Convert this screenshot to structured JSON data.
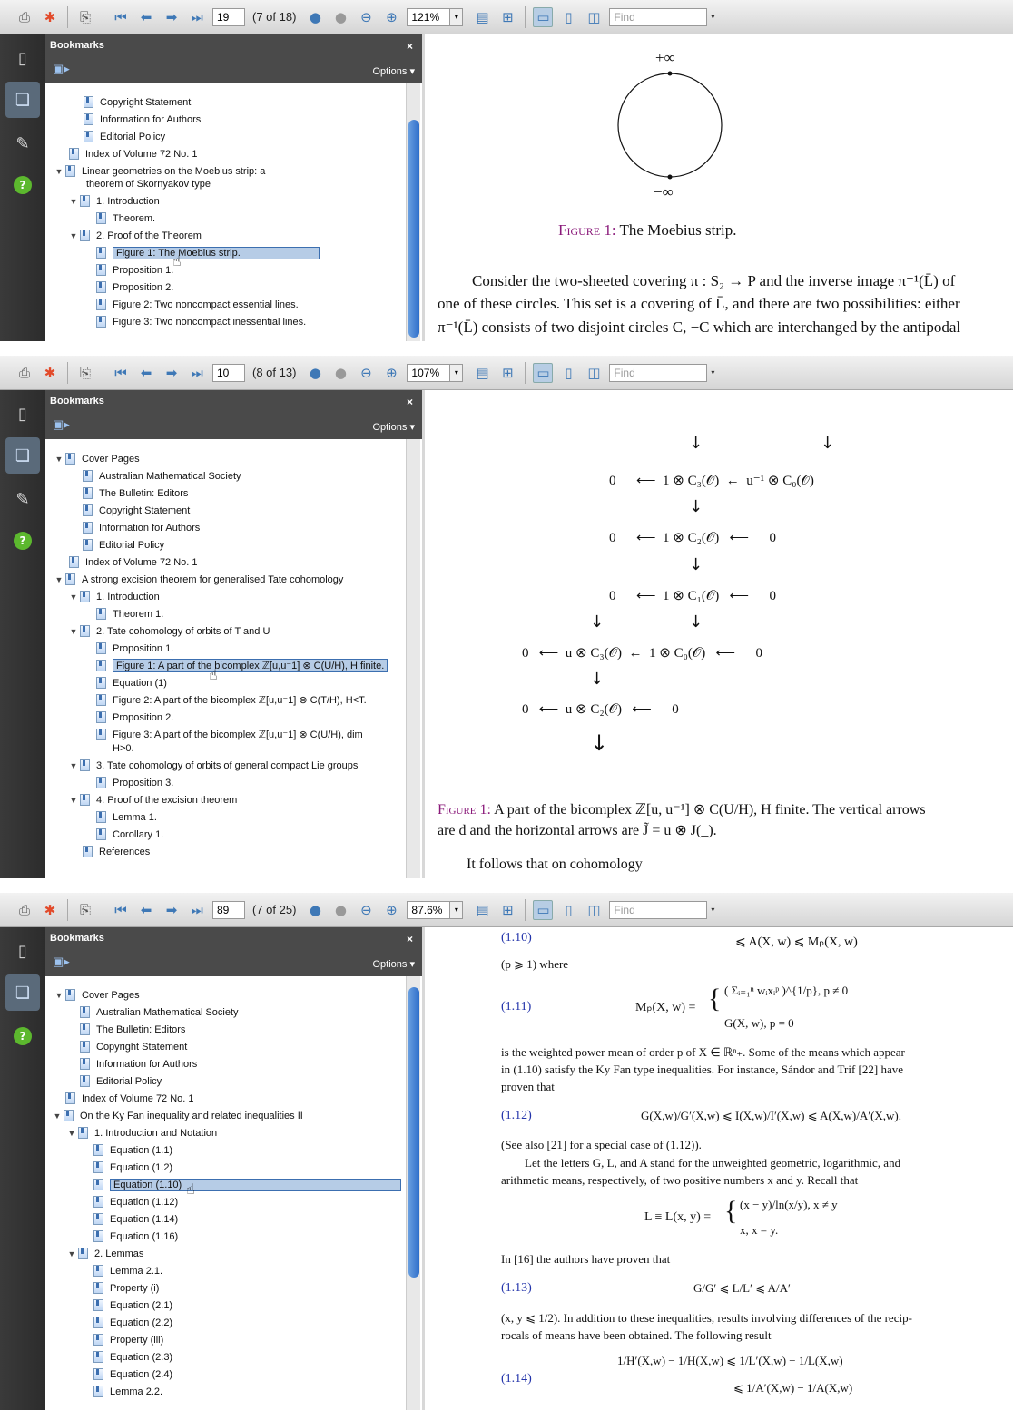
{
  "app": {
    "find_placeholder": "Find",
    "sidebar_title": "Bookmarks",
    "options_label": "Options",
    "close_glyph": "×",
    "help_glyph": "?"
  },
  "windows": [
    {
      "page": "19",
      "page_of": "(7 of 18)",
      "zoom": "121%",
      "tree": [
        "Copyright Statement",
        "Information for Authors",
        "Editorial Policy",
        "Index of Volume 72 No. 1",
        "Linear geometries on the Moebius strip: a",
        "theorem of Skornyakov type",
        "1. Introduction",
        "Theorem.",
        "2. Proof of the Theorem",
        "Figure 1: The Moebius strip.",
        "Proposition 1.",
        "Proposition 2.",
        "Figure 2: Two noncompact essential lines.",
        "Figure 3: Two noncompact inessential lines."
      ],
      "content": {
        "plus_inf": "+∞",
        "minus_inf": "−∞",
        "fig_label": "Figure 1:",
        "fig_caption": "The Moebius strip.",
        "line1": "Consider the two-sheeted covering π : S₂ → P and the inverse image π⁻¹(L̄) of",
        "line2": "one of these circles. This set is a covering of L̄, and there are two possibilities: either",
        "line3": "π⁻¹(L̄) consists of two disjoint circles C, −C which are interchanged by the antipodal"
      }
    },
    {
      "page": "10",
      "page_of": "(8 of 13)",
      "zoom": "107%",
      "tree": [
        "Cover Pages",
        "Australian Mathematical Society",
        "The Bulletin: Editors",
        "Copyright Statement",
        "Information for Authors",
        "Editorial Policy",
        "Index of Volume 72 No. 1",
        "A strong excision theorem for generalised Tate cohomology",
        "1. Introduction",
        "Theorem 1.",
        "2. Tate cohomology of orbits of T and U",
        "Proposition 1.",
        "Figure 1: A part of the bicomplex ℤ[u,u⁻1] ⊗ C(U/H), H finite.",
        "Equation (1)",
        "Figure 2: A part of the bicomplex ℤ[u,u⁻1] ⊗ C(T/H), H<T.",
        "Proposition 2.",
        "Figure 3: A part of the bicomplex ℤ[u,u⁻1] ⊗ C(U/H),  dim",
        "H>0.",
        "3. Tate cohomology of orbits of general compact Lie groups",
        "Proposition 3.",
        "4. Proof of the excision theorem",
        "Lemma 1.",
        "Corollary 1.",
        "References"
      ],
      "content": {
        "r1": [
          "0",
          "⟵",
          "1 ⊗ C₃(𝒪)",
          "←",
          "u⁻¹ ⊗ C₀(𝒪)"
        ],
        "r2": [
          "0",
          "⟵",
          "1 ⊗ C₂(𝒪)",
          "⟵",
          "0"
        ],
        "r3": [
          "0",
          "⟵",
          "1 ⊗ C₁(𝒪)",
          "⟵",
          "0"
        ],
        "r4": [
          "0",
          "⟵",
          "u ⊗ C₃(𝒪)",
          "←",
          "1 ⊗ C₀(𝒪)",
          "⟵",
          "0"
        ],
        "r5": [
          "0",
          "⟵",
          "u ⊗ C₂(𝒪)",
          "⟵",
          "0"
        ],
        "cap_label": "Figure 1:",
        "cap1": "A part of the bicomplex ℤ[u, u⁻¹] ⊗ C(U/H), H finite. The vertical arrows",
        "cap2": "are d and the horizontal arrows are J̃ = u ⊗ J(_).",
        "follow": "It follows that on cohomology"
      }
    },
    {
      "page": "89",
      "page_of": "(7 of 25)",
      "zoom": "87.6%",
      "tree": [
        "Cover Pages",
        "Australian Mathematical Society",
        "The Bulletin: Editors",
        "Copyright Statement",
        "Information for Authors",
        "Editorial Policy",
        "Index of Volume 72 No. 1",
        "On the Ky Fan inequality and related inequalities II",
        "1. Introduction and Notation",
        "Equation (1.1)",
        "Equation (1.2)",
        "Equation (1.10)",
        "Equation (1.12)",
        "Equation (1.14)",
        "Equation (1.16)",
        "2. Lemmas",
        "Lemma 2.1.",
        "Property (i)",
        "Equation (2.1)",
        "Equation (2.2)",
        "Property (iii)",
        "Equation (2.3)",
        "Equation (2.4)",
        "Lemma 2.2."
      ],
      "content": {
        "eq110": "(1.10)",
        "eq110_rhs": "⩽ A(X, w) ⩽ Mₚ(X, w)",
        "where": "(p ⩾ 1) where",
        "eq111": "(1.11)",
        "m_lhs": "Mₚ(X, w) =",
        "m_top": "( Σᵢ₌₁ⁿ wᵢxᵢᵖ )^{1/p},   p ≠ 0",
        "m_bot": "G(X, w),          p = 0",
        "t1": "is the weighted power mean of order p of X ∈ ℝⁿ₊. Some of the means which appear",
        "t2": "in (1.10) satisfy the Ky Fan type inequalities. For instance, Sándor and Trif [22] have",
        "t3": "proven that",
        "eq112": "(1.12)",
        "eq112_body": "G(X,w)/G′(X,w) ⩽ I(X,w)/I′(X,w) ⩽ A(X,w)/A′(X,w).",
        "t4": "(See also [21] for a special case of (1.12)).",
        "t5": "Let the letters G, L, and A stand for the unweighted geometric, logarithmic, and",
        "t6": "arithmetic means, respectively, of two positive numbers x and y. Recall that",
        "l_lhs": "L ≡ L(x, y) =",
        "l_top": "(x − y)/ln(x/y),   x ≠ y",
        "l_bot": "x,                    x = y.",
        "t7": "In [16] the authors have proven that",
        "eq113": "(1.13)",
        "eq113_body": "G/G′ ⩽ L/L′ ⩽ A/A′",
        "t8": "(x, y ⩽ 1/2). In addition to these inequalities, results involving differences of the recip-",
        "t9": "rocals of means have been obtained. The following result",
        "eq114": "(1.14)",
        "e14a": "1/H′(X,w) − 1/H(X,w) ⩽ 1/L′(X,w) − 1/L(X,w)",
        "e14b": "⩽ 1/A′(X,w) − 1/A(X,w)"
      }
    }
  ]
}
